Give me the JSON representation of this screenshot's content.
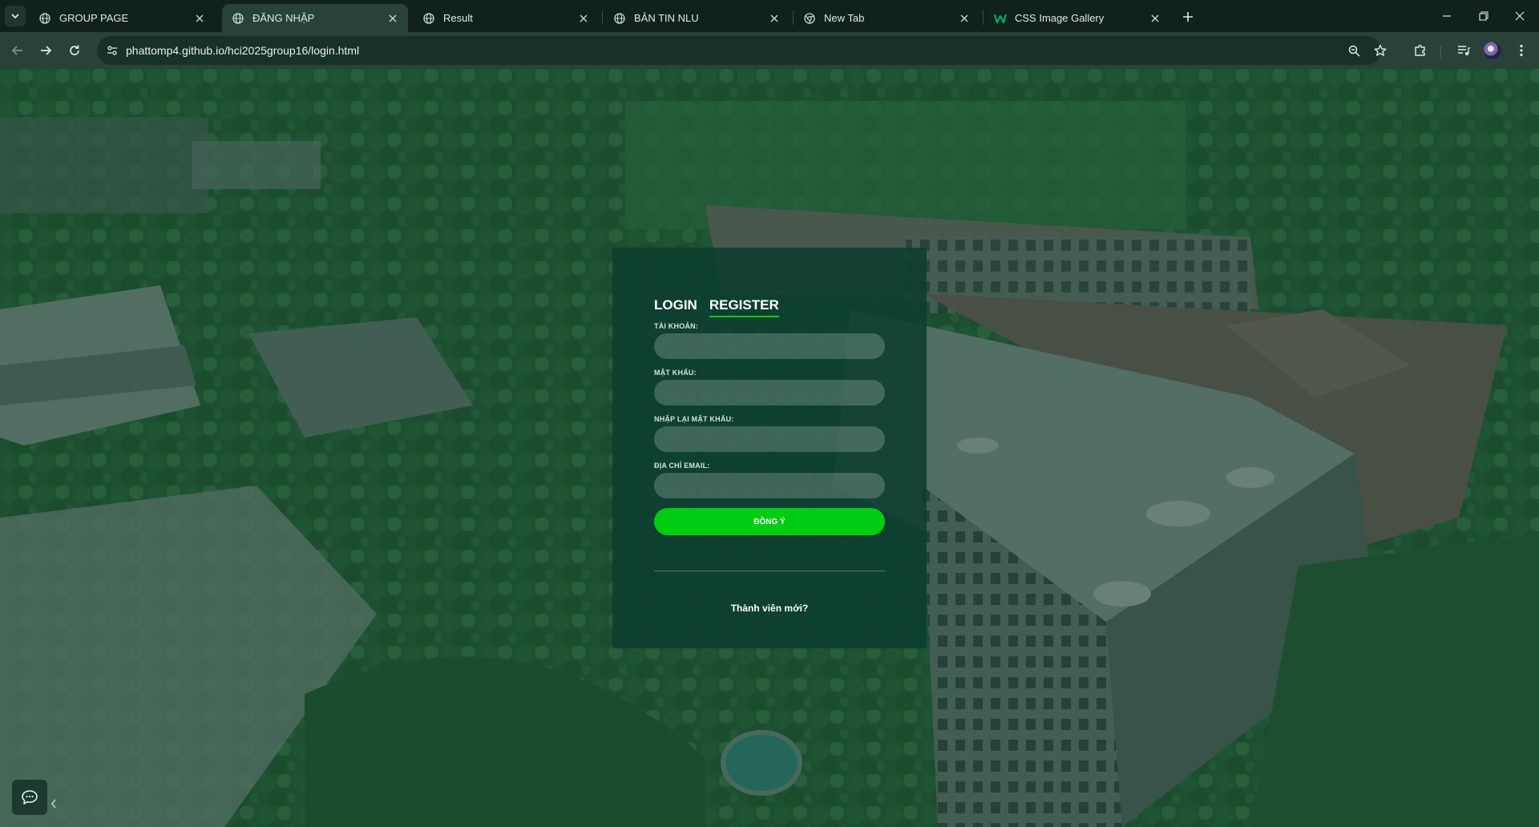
{
  "browser": {
    "tabs": [
      {
        "title": "GROUP PAGE",
        "icon": "globe-icon",
        "active": false
      },
      {
        "title": "ĐĂNG NHẬP",
        "icon": "globe-icon",
        "active": true
      },
      {
        "title": "Result",
        "icon": "globe-icon",
        "active": false
      },
      {
        "title": "BẢN TIN NLU",
        "icon": "globe-icon",
        "active": false
      },
      {
        "title": "New Tab",
        "icon": "chrome-icon",
        "active": false
      },
      {
        "title": "CSS Image Gallery",
        "icon": "w3schools-icon",
        "active": false
      }
    ],
    "url": "phattomp4.github.io/hci2025group16/login.html",
    "accent_color": "#284239"
  },
  "login_card": {
    "tab_login": "LOGIN",
    "tab_register": "REGISTER",
    "selected_tab": "REGISTER",
    "fields": [
      {
        "label": "TÀI KHOẢN:",
        "value": "",
        "type": "text"
      },
      {
        "label": "MẬT KHẨU:",
        "value": "",
        "type": "password"
      },
      {
        "label": "NHẬP LẠI MẬT KHẨU:",
        "value": "",
        "type": "password"
      },
      {
        "label": "ĐỊA CHỈ EMAIL:",
        "value": "",
        "type": "email"
      }
    ],
    "submit_label": "ĐỒNG Ý",
    "new_member_text": "Thành viên mới?",
    "button_color": "#00cc14"
  },
  "chat_widget": {
    "icon": "chat-bubble-icon",
    "collapse_icon": "chevron-left-icon"
  }
}
